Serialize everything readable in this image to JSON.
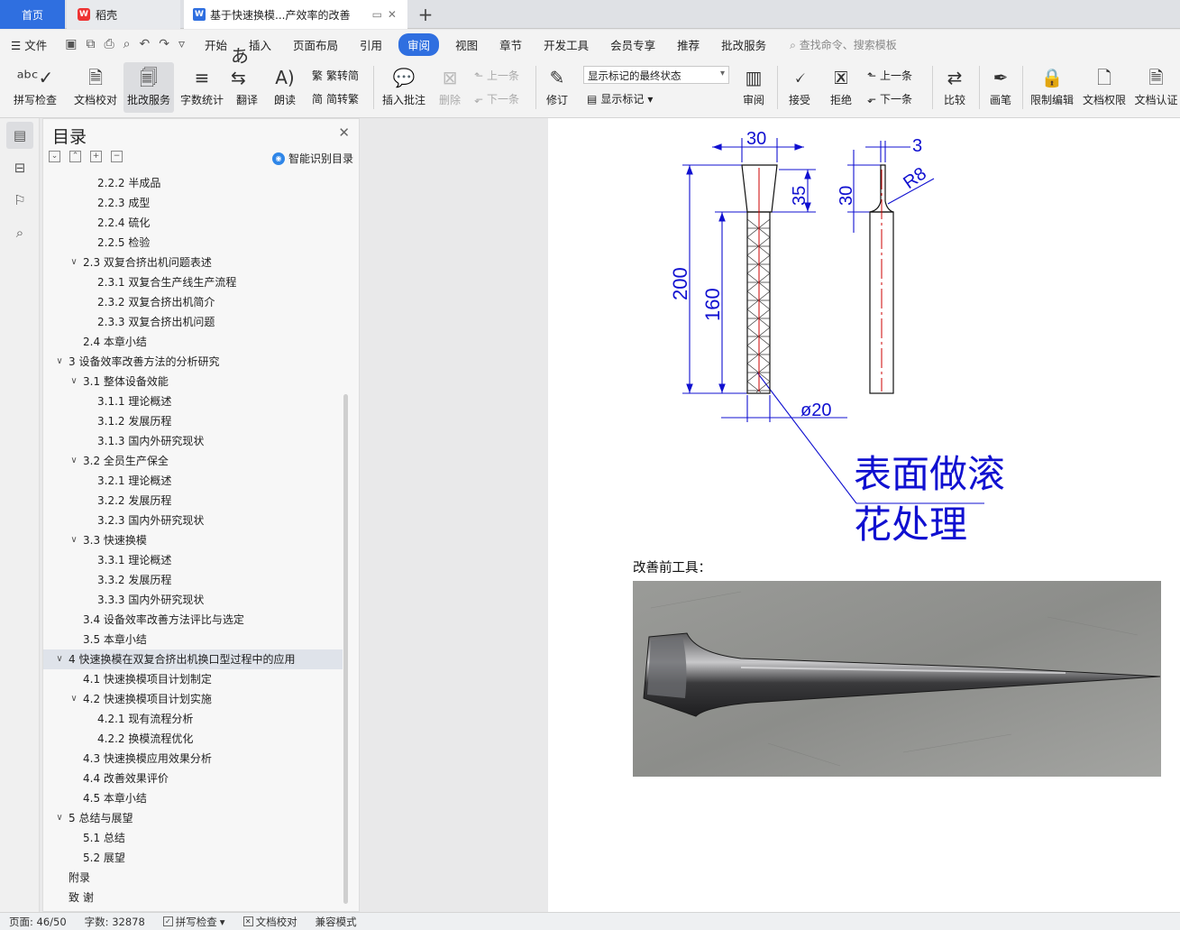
{
  "tabs": {
    "home": "首页",
    "daoke": "稻壳",
    "doc": "基于快速换模...产效率的改善",
    "new_tab": "+"
  },
  "menubar": {
    "file": "文件",
    "items": [
      "开始",
      "插入",
      "页面布局",
      "引用",
      "审阅",
      "视图",
      "章节",
      "开发工具",
      "会员专享",
      "推荐",
      "批改服务"
    ],
    "active": "审阅",
    "search": "查找命令、搜索模板"
  },
  "ribbon": {
    "spell_check": "拼写检查",
    "doc_proof": "文档校对",
    "grading": "批改服务",
    "word_count": "字数统计",
    "translate": "翻译",
    "read_aloud": "朗读",
    "trad_to_simp": "繁转简",
    "simp_to_trad": "简转繁",
    "insert_comment": "插入批注",
    "delete": "删除",
    "prev": "上一条",
    "next": "下一条",
    "revise": "修订",
    "markup_state": "显示标记的最终状态",
    "show_markup": "显示标记",
    "review": "审阅",
    "accept": "接受",
    "reject": "拒绝",
    "prev2": "上一条",
    "next2": "下一条",
    "compare": "比较",
    "pen": "画笔",
    "restrict_edit": "限制编辑",
    "doc_permission": "文档权限",
    "doc_cert": "文档认证"
  },
  "toc": {
    "title": "目录",
    "smart": "智能识别目录",
    "items": [
      {
        "label": "2.2.2  半成品",
        "level": 3
      },
      {
        "label": "2.2.3  成型",
        "level": 3
      },
      {
        "label": "2.2.4  硫化",
        "level": 3
      },
      {
        "label": "2.2.5  检验",
        "level": 3
      },
      {
        "label": "2.3  双复合挤出机问题表述",
        "level": 2,
        "caret": true
      },
      {
        "label": "2.3.1  双复合生产线生产流程",
        "level": 3
      },
      {
        "label": "2.3.2  双复合挤出机简介",
        "level": 3
      },
      {
        "label": "2.3.3  双复合挤出机问题",
        "level": 3
      },
      {
        "label": "2.4  本章小结",
        "level": 2
      },
      {
        "label": "3  设备效率改善方法的分析研究",
        "level": 1,
        "caret": true
      },
      {
        "label": "3.1  整体设备效能",
        "level": 2,
        "caret": true
      },
      {
        "label": "3.1.1  理论概述",
        "level": 3
      },
      {
        "label": "3.1.2  发展历程",
        "level": 3
      },
      {
        "label": "3.1.3  国内外研究现状",
        "level": 3
      },
      {
        "label": "3.2  全员生产保全",
        "level": 2,
        "caret": true
      },
      {
        "label": "3.2.1  理论概述",
        "level": 3
      },
      {
        "label": "3.2.2  发展历程",
        "level": 3
      },
      {
        "label": "3.2.3  国内外研究现状",
        "level": 3
      },
      {
        "label": "3.3  快速换模",
        "level": 2,
        "caret": true
      },
      {
        "label": "3.3.1  理论概述",
        "level": 3
      },
      {
        "label": "3.3.2  发展历程",
        "level": 3
      },
      {
        "label": "3.3.3  国内外研究现状",
        "level": 3
      },
      {
        "label": "3.4  设备效率改善方法评比与选定",
        "level": 2
      },
      {
        "label": "3.5  本章小结",
        "level": 2
      },
      {
        "label": "4  快速换模在双复合挤出机换口型过程中的应用",
        "level": 1,
        "caret": true,
        "selected": true
      },
      {
        "label": "4.1  快速换模项目计划制定",
        "level": 2
      },
      {
        "label": "4.2  快速换模项目计划实施",
        "level": 2,
        "caret": true
      },
      {
        "label": "4.2.1  现有流程分析",
        "level": 3
      },
      {
        "label": "4.2.2  换模流程优化",
        "level": 3
      },
      {
        "label": "4.3  快速换模应用效果分析",
        "level": 2
      },
      {
        "label": "4.4  改善效果评价",
        "level": 2
      },
      {
        "label": "4.5  本章小结",
        "level": 2
      },
      {
        "label": "5  总结与展望",
        "level": 1,
        "caret": true
      },
      {
        "label": "5.1  总结",
        "level": 2
      },
      {
        "label": "5.2  展望",
        "level": 2
      },
      {
        "label": "附录",
        "level": 1
      },
      {
        "label": "致    谢",
        "level": 1
      }
    ]
  },
  "drawing": {
    "dim_30_top": "30",
    "dim_3": "3",
    "dim_35": "35",
    "dim_30_side": "30",
    "dim_r8": "R8",
    "dim_200": "200",
    "dim_160": "160",
    "dim_phi20": "ø20",
    "note_line1": "表面做滚",
    "note_line2": "花处理"
  },
  "document": {
    "caption": "改善前工具："
  },
  "statusbar": {
    "page": "页面: 46/50",
    "words": "字数: 32878",
    "spell": "拼写检查",
    "proof": "文档校对",
    "compat": "兼容模式"
  },
  "colors": {
    "accent": "#2f6fe0",
    "drawing_blue": "#1010d0",
    "drawing_red": "#cc0000"
  }
}
